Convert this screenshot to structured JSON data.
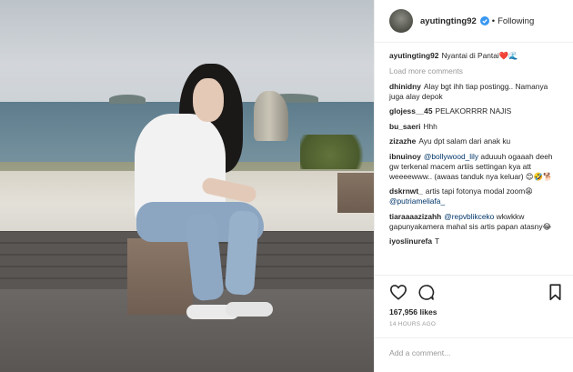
{
  "post": {
    "username": "ayutingting92",
    "follow_state": "Following",
    "separator": "•",
    "caption": {
      "username": "ayutingting92",
      "text": "Nyantai di Pantai",
      "emoji": "❤️🌊"
    },
    "load_more": "Load more comments",
    "comments": [
      {
        "user": "dhinidny",
        "text": "Alay bgt ihh tiap postingg.. Namanya juga alay depok"
      },
      {
        "user": "glojess__45",
        "text": "PELAKORRRR NAJIS"
      },
      {
        "user": "bu_saeri",
        "text": "Hhh"
      },
      {
        "user": "zizazhe",
        "text": "Ayu dpt salam dari anak ku"
      },
      {
        "user": "ibnuinoy",
        "mention": "@bollywood_lily",
        "text": "aduuuh ogaaah deeh gw terkenal macem artiis settingan kya att weeeewww.. (awaas tanduk nya keluar) 😊🤣🐕"
      },
      {
        "user": "dskrnwt_",
        "text": "artis tapi fotonya modal zoom😩",
        "mention_after": "@putriameliafa_"
      },
      {
        "user": "tiaraaaazizahh",
        "mention": "@repvblikceko",
        "text": "wkwkkw gapunyakamera mahal sis artis papan atasny😂"
      },
      {
        "user": "iyoslinurefa",
        "text": "T"
      }
    ],
    "likes": "167,956 likes",
    "time": "14 HOURS AGO",
    "add_comment_placeholder": "Add a comment..."
  },
  "icons": {
    "verified": "verified-badge-icon",
    "like": "heart-outline-icon",
    "comment": "speech-bubble-icon",
    "save": "bookmark-icon"
  },
  "colors": {
    "verified": "#3897f0",
    "mention": "#003569",
    "muted": "#999999",
    "border": "#efefef"
  }
}
